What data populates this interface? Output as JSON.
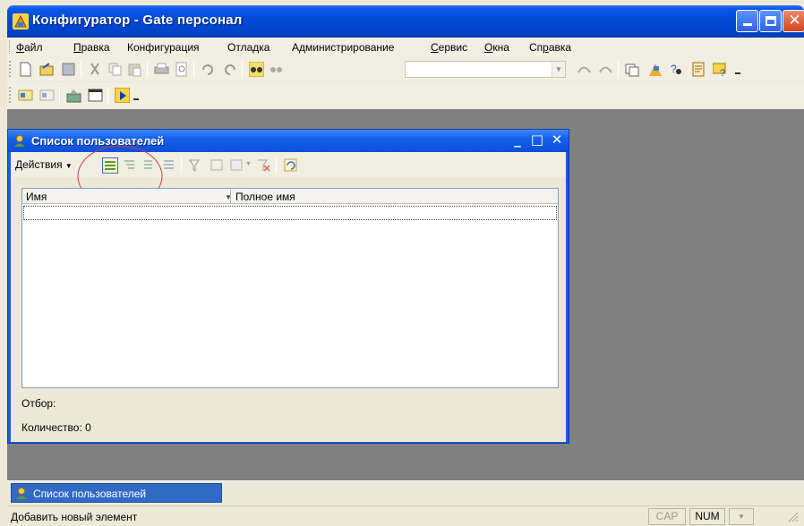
{
  "window": {
    "title": "Конфигуратор - Gate персонал"
  },
  "menu": [
    {
      "label": "Файл",
      "accel_index": 0
    },
    {
      "label": "Правка",
      "accel_index": 0
    },
    {
      "label": "Конфигурация",
      "accel_index": -1
    },
    {
      "label": "Отладка",
      "accel_index": -1
    },
    {
      "label": "Администрирование",
      "accel_index": -1
    },
    {
      "label": "Сервис",
      "accel_index": 0
    },
    {
      "label": "Окна",
      "accel_index": 0
    },
    {
      "label": "Справка",
      "accel_index": 2
    }
  ],
  "toolbar": {
    "search_value": ""
  },
  "child_window": {
    "title": "Список пользователей",
    "actions_label": "Действия",
    "columns": [
      "Имя",
      "Полное имя"
    ],
    "rows": [],
    "filter_label": "Отбор:",
    "count_label": "Количество: 0"
  },
  "window_tab": {
    "label": "Список пользователей"
  },
  "status": {
    "text": "Добавить новый элемент",
    "cap": "CAP",
    "num": "NUM"
  },
  "colors": {
    "title_blue": "#0149d6",
    "mdi_background": "#808080",
    "highlight_circle": "#d43c3c"
  }
}
